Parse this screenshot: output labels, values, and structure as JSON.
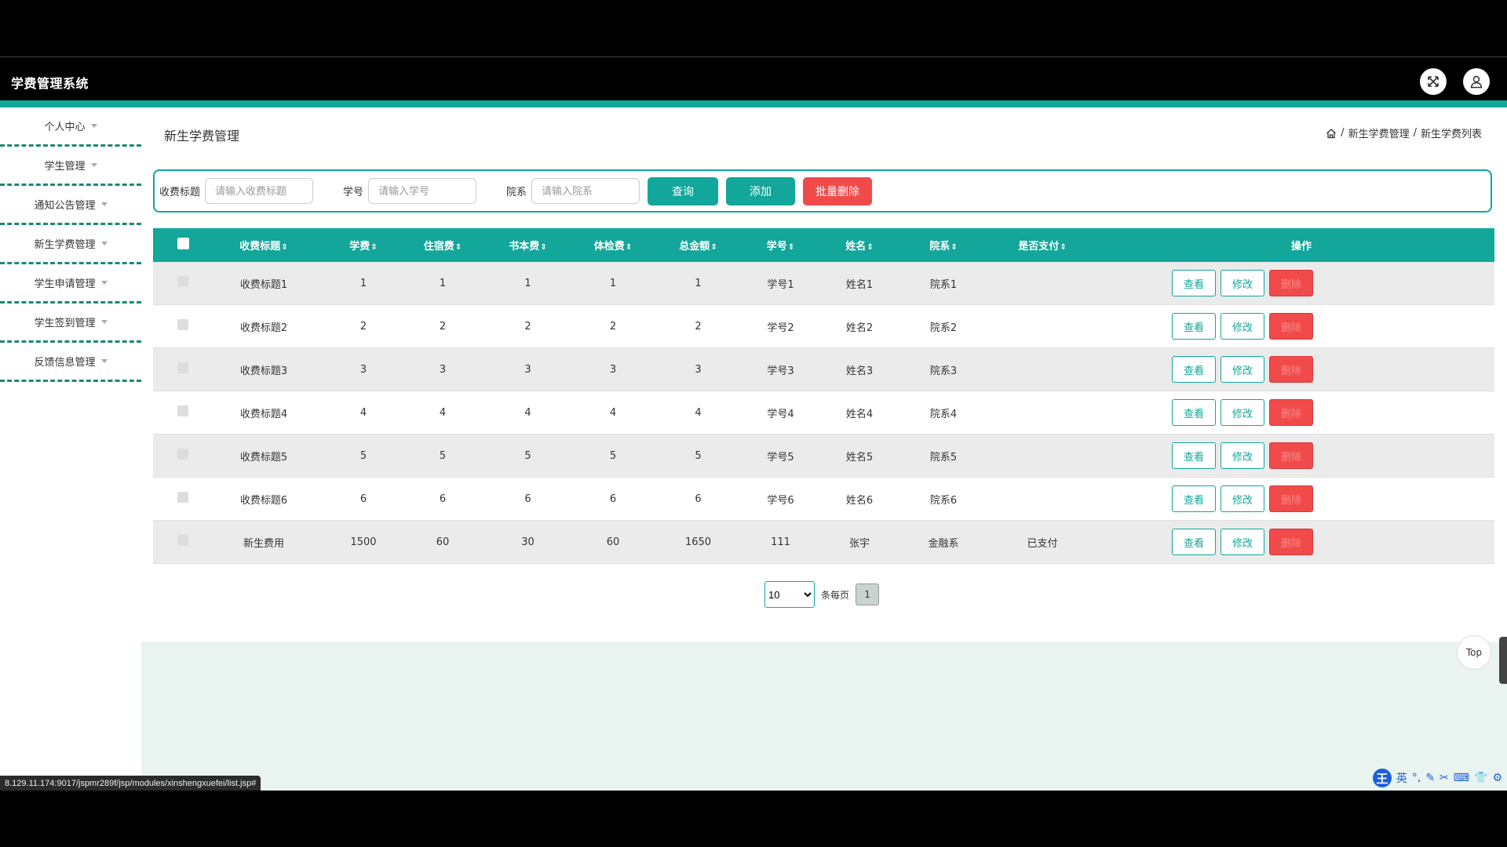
{
  "app": {
    "title": "学费管理系统"
  },
  "nav": {
    "fullscreen_icon": "expand-icon",
    "user_icon": "user-icon"
  },
  "sidebar": {
    "items": [
      {
        "label": "个人中心"
      },
      {
        "label": "学生管理"
      },
      {
        "label": "通知公告管理"
      },
      {
        "label": "新生学费管理"
      },
      {
        "label": "学生申请管理"
      },
      {
        "label": "学生签到管理"
      },
      {
        "label": "反馈信息管理"
      }
    ]
  },
  "page": {
    "heading": "新生学费管理",
    "breadcrumb": [
      "新生学费管理",
      "新生学费列表"
    ],
    "breadcrumb_sep": "/"
  },
  "search": {
    "title_label": "收费标题",
    "title_placeholder": "请输入收费标题",
    "xuehao_label": "学号",
    "xuehao_placeholder": "请输入学号",
    "yuanxi_label": "院系",
    "yuanxi_placeholder": "请输入院系",
    "query_btn": "查询",
    "add_btn": "添加",
    "batch_delete_btn": "批量删除"
  },
  "table": {
    "headers": [
      "收费标题",
      "学费",
      "住宿费",
      "书本费",
      "体检费",
      "总金额",
      "学号",
      "姓名",
      "院系",
      "是否支付",
      "操作"
    ],
    "sort_icon": "⇕",
    "rows": [
      [
        "收费标题1",
        "1",
        "1",
        "1",
        "1",
        "1",
        "学号1",
        "姓名1",
        "院系1",
        ""
      ],
      [
        "收费标题2",
        "2",
        "2",
        "2",
        "2",
        "2",
        "学号2",
        "姓名2",
        "院系2",
        ""
      ],
      [
        "收费标题3",
        "3",
        "3",
        "3",
        "3",
        "3",
        "学号3",
        "姓名3",
        "院系3",
        ""
      ],
      [
        "收费标题4",
        "4",
        "4",
        "4",
        "4",
        "4",
        "学号4",
        "姓名4",
        "院系4",
        ""
      ],
      [
        "收费标题5",
        "5",
        "5",
        "5",
        "5",
        "5",
        "学号5",
        "姓名5",
        "院系5",
        ""
      ],
      [
        "收费标题6",
        "6",
        "6",
        "6",
        "6",
        "6",
        "学号6",
        "姓名6",
        "院系6",
        ""
      ],
      [
        "新生费用",
        "1500",
        "60",
        "30",
        "60",
        "1650",
        "111",
        "张宇",
        "金融系",
        "已支付"
      ]
    ],
    "actions": {
      "view": "查看",
      "edit": "修改",
      "delete": "删除"
    }
  },
  "pager": {
    "page_size": "10",
    "page_size_options": [
      "10"
    ],
    "per_page_label": "条每页",
    "current_page": "1"
  },
  "misc": {
    "top_btn": "Top",
    "status_url": "8.129.11.174:9017/jspmr289f/jsp/modules/xinshengxuefei/list.jsp#",
    "ime_label": "英"
  },
  "colors": {
    "accent": "#13a69a",
    "danger": "#f14a4a",
    "footer_bg": "#e9f3ef"
  }
}
